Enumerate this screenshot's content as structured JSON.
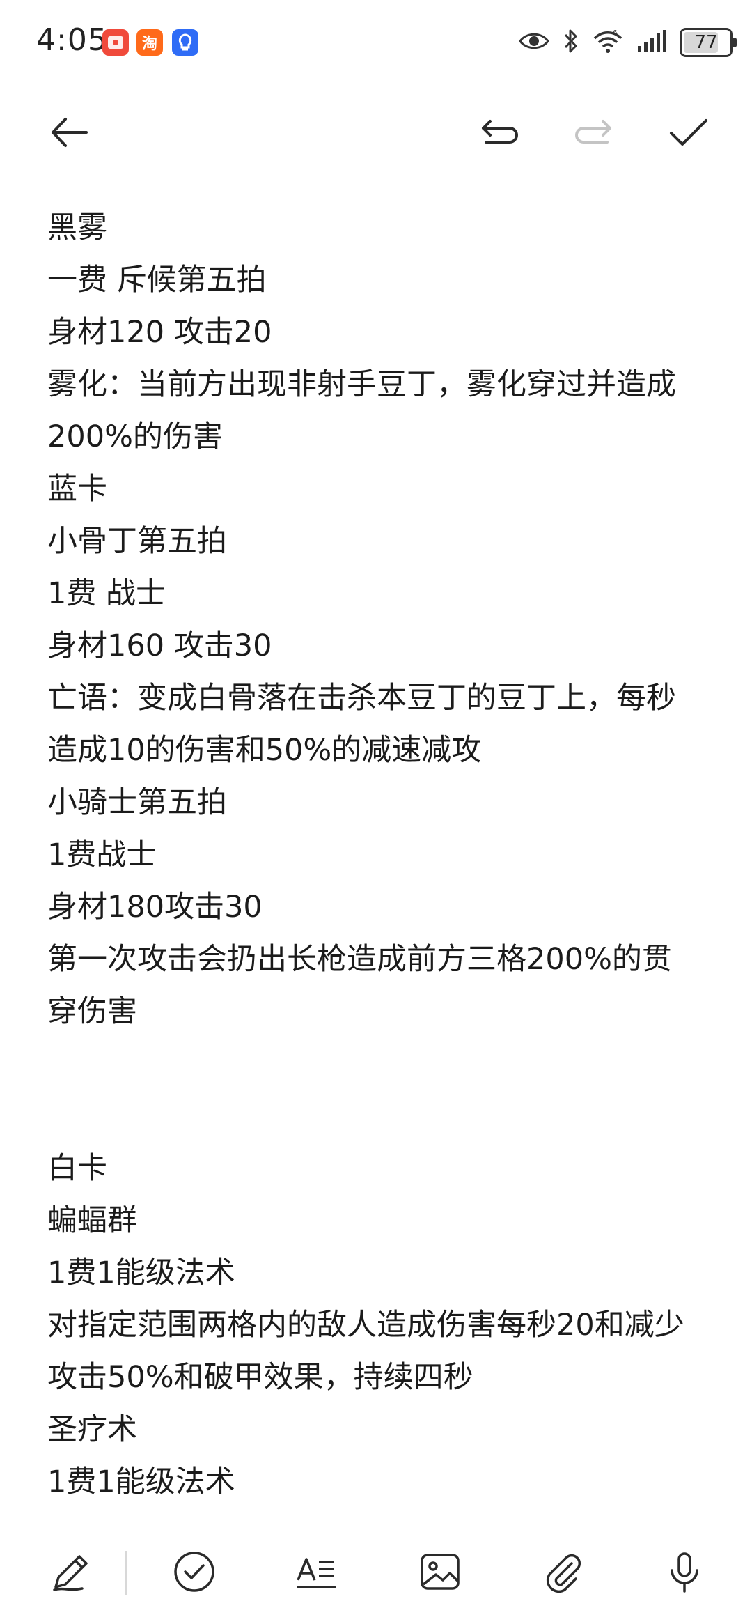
{
  "status_bar": {
    "time": "4:05",
    "battery": "77",
    "battery_level": 0.77,
    "icons": [
      "eye-icon",
      "bluetooth-icon",
      "wifi-6-icon",
      "signal-icon",
      "battery-icon"
    ],
    "app_badges": [
      "app-badge-red-icon",
      "taobao-app-icon",
      "blue-app-icon"
    ],
    "taobao_badge_glyph": "淘"
  },
  "toolbar": {
    "back_icon": "arrow-left-icon",
    "undo_icon": "undo-icon",
    "redo_icon": "redo-icon",
    "done_icon": "check-icon"
  },
  "note": {
    "lines": [
      "黑雾",
      "一费 斥候第五拍",
      "身材120 攻击20",
      "雾化：当前方出现非射手豆丁，雾化穿过并造成",
      "200%的伤害",
      "蓝卡",
      "小骨丁第五拍",
      "1费 战士",
      "身材160 攻击30",
      "亡语：变成白骨落在击杀本豆丁的豆丁上，每秒",
      "造成10的伤害和50%的减速减攻",
      "小骑士第五拍",
      "1费战士",
      "身材180攻击30",
      "第一次攻击会扔出长枪造成前方三格200%的贯",
      "穿伤害",
      "",
      "",
      "白卡",
      "蝙蝠群",
      "1费1能级法术",
      "对指定范围两格内的敌人造成伤害每秒20和减少",
      "攻击50%和破甲效果，持续四秒",
      "圣疗术",
      "1费1能级法术"
    ]
  },
  "bottom_bar": {
    "tools": [
      "pen-icon",
      "checklist-icon",
      "text-format-icon",
      "image-icon",
      "attachment-icon",
      "microphone-icon"
    ]
  },
  "colors": {
    "text": "#1b1b1b",
    "icon": "#2a2a2a",
    "icon_disabled": "#c4c4c4",
    "background": "#ffffff"
  }
}
